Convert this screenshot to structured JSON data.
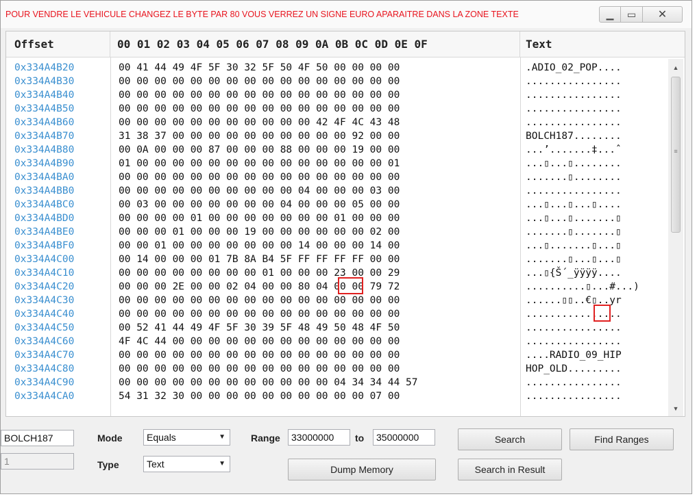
{
  "window": {
    "title": "POUR VENDRE LE VEHICULE CHANGEZ LE BYTE PAR 80 VOUS VERREZ UN SIGNE EURO APARAITRE DANS LA ZONE TEXTE",
    "buttons": {
      "minimize": "▁",
      "maximize": "▭",
      "close": "✕"
    }
  },
  "grid": {
    "headers": {
      "offset": "Offset",
      "hex": "00 01 02 03 04 05 06 07 08 09 0A 0B 0C 0D 0E 0F",
      "text": "Text"
    },
    "rows": [
      {
        "offset": "0x334A4B20",
        "hex": "00 41 44 49 4F 5F 30 32 5F 50 4F 50 00 00 00 00",
        "text": ".ADIO_02_POP...."
      },
      {
        "offset": "0x334A4B30",
        "hex": "00 00 00 00 00 00 00 00 00 00 00 00 00 00 00 00",
        "text": "................"
      },
      {
        "offset": "0x334A4B40",
        "hex": "00 00 00 00 00 00 00 00 00 00 00 00 00 00 00 00",
        "text": "................"
      },
      {
        "offset": "0x334A4B50",
        "hex": "00 00 00 00 00 00 00 00 00 00 00 00 00 00 00 00",
        "text": "................"
      },
      {
        "offset": "0x334A4B60",
        "hex": "00 00 00 00 00 00 00 00 00 00 00 42 4F 4C 43 48",
        "text": "................"
      },
      {
        "offset": "0x334A4B70",
        "hex": "31 38 37 00 00 00 00 00 00 00 00 00 00 92 00 00",
        "text": "BOLCH187........"
      },
      {
        "offset": "0x334A4B80",
        "hex": "00 0A 00 00 00 87 00 00 00 88 00 00 00 19 00 00",
        "text": "...’.......‡...ˆ"
      },
      {
        "offset": "0x334A4B90",
        "hex": "01 00 00 00 00 00 00 00 00 00 00 00 00 00 00 01",
        "text": "...▯...▯........"
      },
      {
        "offset": "0x334A4BA0",
        "hex": "00 00 00 00 00 00 00 00 00 00 00 00 00 00 00 00",
        "text": ".......▯........"
      },
      {
        "offset": "0x334A4BB0",
        "hex": "00 00 00 00 00 00 00 00 00 00 04 00 00 00 03 00",
        "text": "................"
      },
      {
        "offset": "0x334A4BC0",
        "hex": "00 03 00 00 00 00 00 00 00 04 00 00 00 05 00 00",
        "text": "...▯...▯...▯...."
      },
      {
        "offset": "0x334A4BD0",
        "hex": "00 00 00 00 01 00 00 00 00 00 00 00 01 00 00 00",
        "text": "...▯...▯.......▯"
      },
      {
        "offset": "0x334A4BE0",
        "hex": "00 00 00 01 00 00 00 19 00 00 00 00 00 00 02 00",
        "text": ".......▯.......▯"
      },
      {
        "offset": "0x334A4BF0",
        "hex": "00 00 01 00 00 00 00 00 00 00 14 00 00 00 14 00",
        "text": "...▯.......▯...▯"
      },
      {
        "offset": "0x334A4C00",
        "hex": "00 14 00 00 00 01 7B 8A B4 5F FF FF FF FF 00 00",
        "text": ".......▯...▯...▯"
      },
      {
        "offset": "0x334A4C10",
        "hex": "00 00 00 00 00 00 00 00 01 00 00 00 23 00 00 29",
        "text": "...▯{Š´_ÿÿÿÿ...."
      },
      {
        "offset": "0x334A4C20",
        "hex": "00 00 00 2E 00 00 02 04 00 00 80 04 00 00 79 72",
        "text": "..........▯...#...)"
      },
      {
        "offset": "0x334A4C30",
        "hex": "00 00 00 00 00 00 00 00 00 00 00 00 00 00 00 00",
        "text": "......▯▯..€▯..yr"
      },
      {
        "offset": "0x334A4C40",
        "hex": "00 00 00 00 00 00 00 00 00 00 00 00 00 00 00 00",
        "text": "................"
      },
      {
        "offset": "0x334A4C50",
        "hex": "00 52 41 44 49 4F 5F 30 39 5F 48 49 50 48 4F 50",
        "text": "................"
      },
      {
        "offset": "0x334A4C60",
        "hex": "4F 4C 44 00 00 00 00 00 00 00 00 00 00 00 00 00",
        "text": "................"
      },
      {
        "offset": "0x334A4C70",
        "hex": "00 00 00 00 00 00 00 00 00 00 00 00 00 00 00 00",
        "text": "....RADIO_09_HIP"
      },
      {
        "offset": "0x334A4C80",
        "hex": "00 00 00 00 00 00 00 00 00 00 00 00 00 00 00 00",
        "text": "HOP_OLD........."
      },
      {
        "offset": "0x334A4C90",
        "hex": "00 00 00 00 00 00 00 00 00 00 00 00 04 34 34 44 57",
        "text": "................"
      },
      {
        "offset": "0x334A4CA0",
        "hex": "54 31 32 30 00 00 00 00 00 00 00 00 00 00 07 00",
        "text": "................"
      }
    ]
  },
  "controls": {
    "search_value": "BOLCH187",
    "result_value": "1",
    "mode_label": "Mode",
    "mode_value": "Equals",
    "type_label": "Type",
    "type_value": "Text",
    "range_label": "Range",
    "range_from": "33000000",
    "to_label": "to",
    "range_to": "35000000",
    "search_button": "Search",
    "find_ranges_button": "Find Ranges",
    "dump_memory_button": "Dump Memory",
    "search_in_result_button": "Search in Result"
  },
  "colors": {
    "title": "#e8141e",
    "offset": "#3a8fd0",
    "highlight": "#e02020"
  }
}
